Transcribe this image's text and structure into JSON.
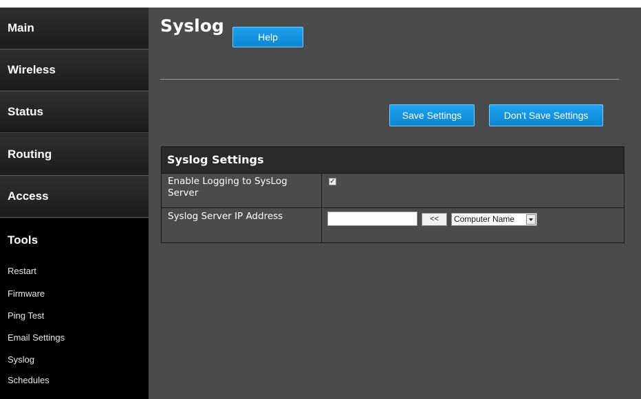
{
  "sidebar": {
    "items": [
      {
        "label": "Main"
      },
      {
        "label": "Wireless"
      },
      {
        "label": "Status"
      },
      {
        "label": "Routing"
      },
      {
        "label": "Access"
      },
      {
        "label": "Tools"
      }
    ],
    "active": "Tools",
    "subitems": [
      {
        "label": "Restart"
      },
      {
        "label": "Firmware"
      },
      {
        "label": "Ping Test"
      },
      {
        "label": "Email Settings"
      },
      {
        "label": "Syslog"
      },
      {
        "label": "Schedules"
      }
    ]
  },
  "page": {
    "title": "Syslog",
    "help_label": "Help",
    "save_label": "Save Settings",
    "nosave_label": "Don't Save Settings"
  },
  "panel": {
    "header": "Syslog Settings",
    "enable_label": "Enable Logging to SysLog Server",
    "enable_checked": true,
    "ip_label": "Syslog Server IP Address",
    "ip_value": "",
    "copy_label": "<<",
    "select_value": "Computer Name"
  },
  "colors": {
    "accent": "#1ea2ef",
    "main_bg": "#4a4b4d",
    "sidebar_bg": "#1b1b1b",
    "panel_header_bg": "#2a2a2b"
  }
}
